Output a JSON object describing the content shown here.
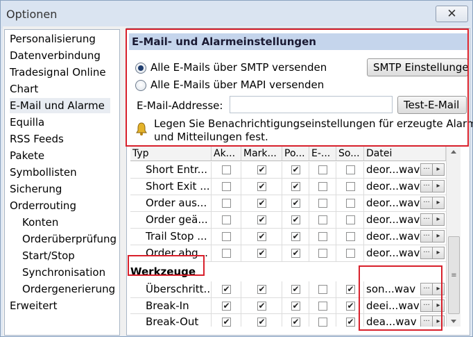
{
  "window": {
    "title": "Optionen",
    "close": "✕"
  },
  "nav": {
    "items": [
      {
        "label": "Personalisierung",
        "indent": 0,
        "selected": false
      },
      {
        "label": "Datenverbindung",
        "indent": 0,
        "selected": false
      },
      {
        "label": "Tradesignal Online",
        "indent": 0,
        "selected": false
      },
      {
        "label": "Chart",
        "indent": 0,
        "selected": false
      },
      {
        "label": "E-Mail und Alarme",
        "indent": 0,
        "selected": true
      },
      {
        "label": "Equilla",
        "indent": 0,
        "selected": false
      },
      {
        "label": "RSS Feeds",
        "indent": 0,
        "selected": false
      },
      {
        "label": "Pakete",
        "indent": 0,
        "selected": false
      },
      {
        "label": "Symbollisten",
        "indent": 0,
        "selected": false
      },
      {
        "label": "Sicherung",
        "indent": 0,
        "selected": false
      },
      {
        "label": "Orderrouting",
        "indent": 0,
        "selected": false
      },
      {
        "label": "Konten",
        "indent": 1,
        "selected": false
      },
      {
        "label": "Orderüberprüfung",
        "indent": 1,
        "selected": false
      },
      {
        "label": "Start/Stop",
        "indent": 1,
        "selected": false
      },
      {
        "label": "Synchronisation",
        "indent": 1,
        "selected": false
      },
      {
        "label": "Ordergenerierung",
        "indent": 1,
        "selected": false
      },
      {
        "label": "Erweitert",
        "indent": 0,
        "selected": false
      }
    ]
  },
  "email": {
    "section_title": "E-Mail- und Alarmeinstellungen",
    "radio_smtp": "Alle E-Mails über SMTP versenden",
    "radio_mapi": "Alle E-Mails über MAPI versenden",
    "smtp_selected": true,
    "smtp_button": "SMTP Einstellungen",
    "email_label": "E-Mail-Addresse:",
    "email_value": "",
    "test_button": "Test-E-Mail",
    "hint_line1": "Legen Sie Benachrichtigungseinstellungen für erzeugte Alarme",
    "hint_line2": "und Mitteilungen fest."
  },
  "grid": {
    "columns": [
      "Typ",
      "Ak...",
      "Mark...",
      "Po...",
      "E-...",
      "So...",
      "Datei"
    ],
    "rows_top": [
      {
        "typ": "Short Entr...",
        "c": [
          false,
          true,
          true,
          false,
          false
        ],
        "file": "deor...wav"
      },
      {
        "typ": "Short Exit ...",
        "c": [
          false,
          true,
          true,
          false,
          false
        ],
        "file": "deor...wav"
      },
      {
        "typ": "Order aus...",
        "c": [
          false,
          true,
          true,
          false,
          false
        ],
        "file": "deor...wav"
      },
      {
        "typ": "Order geä...",
        "c": [
          false,
          true,
          true,
          false,
          false
        ],
        "file": "deor...wav"
      },
      {
        "typ": "Trail Stop ...",
        "c": [
          false,
          true,
          true,
          false,
          false
        ],
        "file": "deor...wav"
      },
      {
        "typ": "Order abg...",
        "c": [
          false,
          true,
          true,
          false,
          false
        ],
        "file": "deor...wav"
      }
    ],
    "group_label": "Werkzeuge",
    "rows_bottom": [
      {
        "typ": "Überschritt...",
        "c": [
          true,
          true,
          true,
          false,
          true
        ],
        "file": "son...wav"
      },
      {
        "typ": "Break-In",
        "c": [
          true,
          true,
          true,
          false,
          true
        ],
        "file": "deei...wav"
      },
      {
        "typ": "Break-Out",
        "c": [
          true,
          true,
          true,
          false,
          true
        ],
        "file": "dea...wav"
      }
    ],
    "browse_label": "···",
    "play_label": "▸",
    "checkmark": "✔",
    "scroll_grip": "≡"
  },
  "colors": {
    "highlight": "#d8202b",
    "section_header_bg": "#c5d5ec",
    "window_bg": "#dfe8f3"
  }
}
